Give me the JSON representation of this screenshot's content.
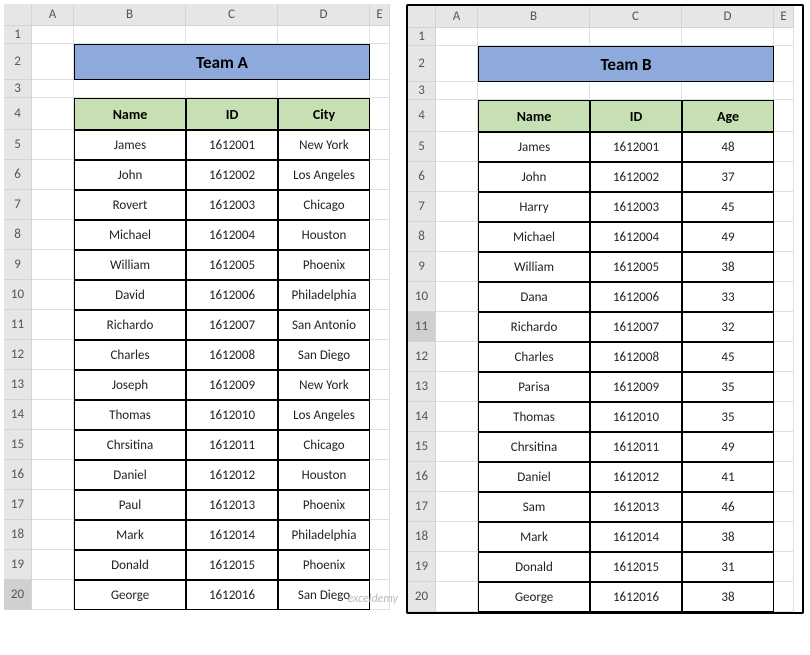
{
  "columns": [
    "A",
    "B",
    "C",
    "D",
    "E"
  ],
  "teamA": {
    "title": "Team A",
    "headers": [
      "Name",
      "ID",
      "City"
    ],
    "rows": [
      {
        "name": "James",
        "id": "1612001",
        "val": "New York"
      },
      {
        "name": "John",
        "id": "1612002",
        "val": "Los Angeles"
      },
      {
        "name": "Rovert",
        "id": "1612003",
        "val": "Chicago"
      },
      {
        "name": "Michael",
        "id": "1612004",
        "val": "Houston"
      },
      {
        "name": "William",
        "id": "1612005",
        "val": "Phoenix"
      },
      {
        "name": "David",
        "id": "1612006",
        "val": "Philadelphia"
      },
      {
        "name": "Richardo",
        "id": "1612007",
        "val": "San Antonio"
      },
      {
        "name": "Charles",
        "id": "1612008",
        "val": "San Diego"
      },
      {
        "name": "Joseph",
        "id": "1612009",
        "val": "New York"
      },
      {
        "name": "Thomas",
        "id": "1612010",
        "val": "Los Angeles"
      },
      {
        "name": "Chrsitina",
        "id": "1612011",
        "val": "Chicago"
      },
      {
        "name": "Daniel",
        "id": "1612012",
        "val": "Houston"
      },
      {
        "name": "Paul",
        "id": "1612013",
        "val": "Phoenix"
      },
      {
        "name": "Mark",
        "id": "1612014",
        "val": "Philadelphia"
      },
      {
        "name": "Donald",
        "id": "1612015",
        "val": "Phoenix"
      },
      {
        "name": "George",
        "id": "1612016",
        "val": "San Diego"
      }
    ],
    "selectedRow": 20
  },
  "teamB": {
    "title": "Team B",
    "headers": [
      "Name",
      "ID",
      "Age"
    ],
    "rows": [
      {
        "name": "James",
        "id": "1612001",
        "val": "48"
      },
      {
        "name": "John",
        "id": "1612002",
        "val": "37"
      },
      {
        "name": "Harry",
        "id": "1612003",
        "val": "45"
      },
      {
        "name": "Michael",
        "id": "1612004",
        "val": "49"
      },
      {
        "name": "William",
        "id": "1612005",
        "val": "38"
      },
      {
        "name": "Dana",
        "id": "1612006",
        "val": "33"
      },
      {
        "name": "Richardo",
        "id": "1612007",
        "val": "32"
      },
      {
        "name": "Charles",
        "id": "1612008",
        "val": "45"
      },
      {
        "name": "Parisa",
        "id": "1612009",
        "val": "35"
      },
      {
        "name": "Thomas",
        "id": "1612010",
        "val": "35"
      },
      {
        "name": "Chrsitina",
        "id": "1612011",
        "val": "49"
      },
      {
        "name": "Daniel",
        "id": "1612012",
        "val": "41"
      },
      {
        "name": "Sam",
        "id": "1612013",
        "val": "46"
      },
      {
        "name": "Mark",
        "id": "1612014",
        "val": "38"
      },
      {
        "name": "Donald",
        "id": "1612015",
        "val": "31"
      },
      {
        "name": "George",
        "id": "1612016",
        "val": "38"
      }
    ],
    "selectedRow": 11
  },
  "watermark": "exceldemy"
}
